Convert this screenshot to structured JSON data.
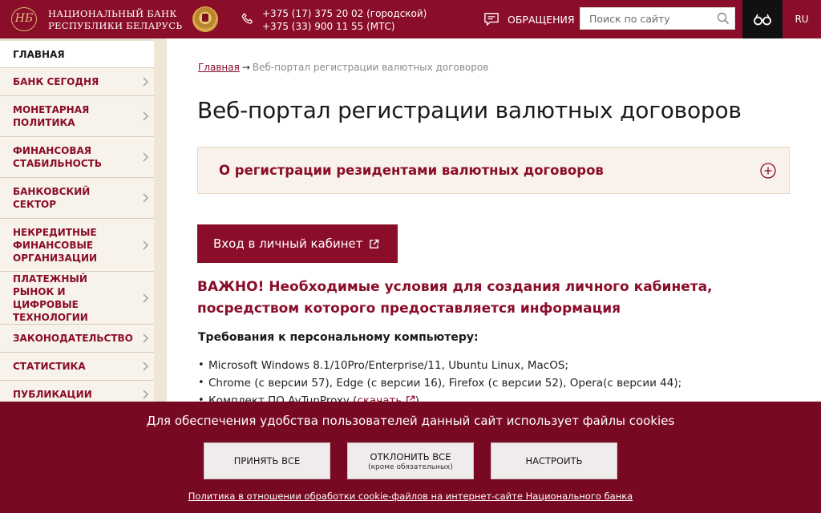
{
  "header": {
    "logo_text": "НБ",
    "bank_name_line1": "НАЦИОНАЛЬНЫЙ БАНК",
    "bank_name_line2": "РЕСПУБЛИКИ БЕЛАРУСЬ",
    "phone_city": "+375 (17) 375 20 02 (городской)",
    "phone_mobile": "+375 (33) 900 11 55 (МТС)",
    "appeals_label": "ОБРАЩЕНИЯ",
    "search_placeholder": "Поиск по сайту",
    "lang_label": "RU"
  },
  "sidebar": {
    "items": [
      {
        "label": "ГЛАВНАЯ"
      },
      {
        "label": "БАНК СЕГОДНЯ"
      },
      {
        "label": "МОНЕТАРНАЯ ПОЛИТИКА"
      },
      {
        "label": "ФИНАНСОВАЯ СТАБИЛЬНОСТЬ"
      },
      {
        "label": "БАНКОВСКИЙ СЕКТОР"
      },
      {
        "label": "НЕКРЕДИТНЫЕ ФИНАНСОВЫЕ ОРГАНИЗАЦИИ"
      },
      {
        "label": "ПЛАТЕЖНЫЙ РЫНОК И ЦИФРОВЫЕ ТЕХНОЛОГИИ"
      },
      {
        "label": "ЗАКОНОДАТЕЛЬСТВО"
      },
      {
        "label": "СТАТИСТИКА"
      },
      {
        "label": "ПУБЛИКАЦИИ"
      }
    ]
  },
  "main": {
    "breadcrumb_home": "Главная",
    "breadcrumb_arrow": "→",
    "breadcrumb_current": "Веб-портал регистрации валютных договоров",
    "title": "Веб-портал регистрации валютных договоров",
    "accordion_title": "О регистрации резидентами валютных договоров",
    "login_button": "Вход в личный кабинет",
    "important_text": "ВАЖНО! Необходимые условия для создания личного кабинета, посредством которого предоставляется информация",
    "requirements_title": "Требования к персональному компьютеру:",
    "req_os": "Microsoft Windows 8.1/10Pro/Enterprise/11, Ubuntu Linux, MacOS;",
    "req_browsers": "Chrome (с версии 57), Edge (с версии 16), Firefox (с версии 52), Opera(с версии 44);",
    "req_software_prefix": "Комплект ПО AvTunProxy (",
    "req_software_link": "скачать",
    "req_software_suffix": ")"
  },
  "cookie": {
    "message": "Для обеспечения удобства пользователей данный сайт использует файлы cookies",
    "accept": "ПРИНЯТЬ ВСЕ",
    "decline": "ОТКЛОНИТЬ ВСЕ",
    "decline_note": "(кроме обязательных)",
    "configure": "НАСТРОИТЬ",
    "policy_link": "Политика в отношении обработки cookie-файлов на интернет-сайте Национального банка"
  },
  "colors": {
    "brand": "#8a0d2a",
    "cookie_bg": "#780922",
    "sidebar_bg": "#e9dfcf"
  },
  "icons": [
    "logo-icon",
    "emblem-icon",
    "phone-icon",
    "appeals-icon",
    "search-icon",
    "vision-icon",
    "chevron-right-icon",
    "plus-circle-icon",
    "external-link-icon"
  ]
}
